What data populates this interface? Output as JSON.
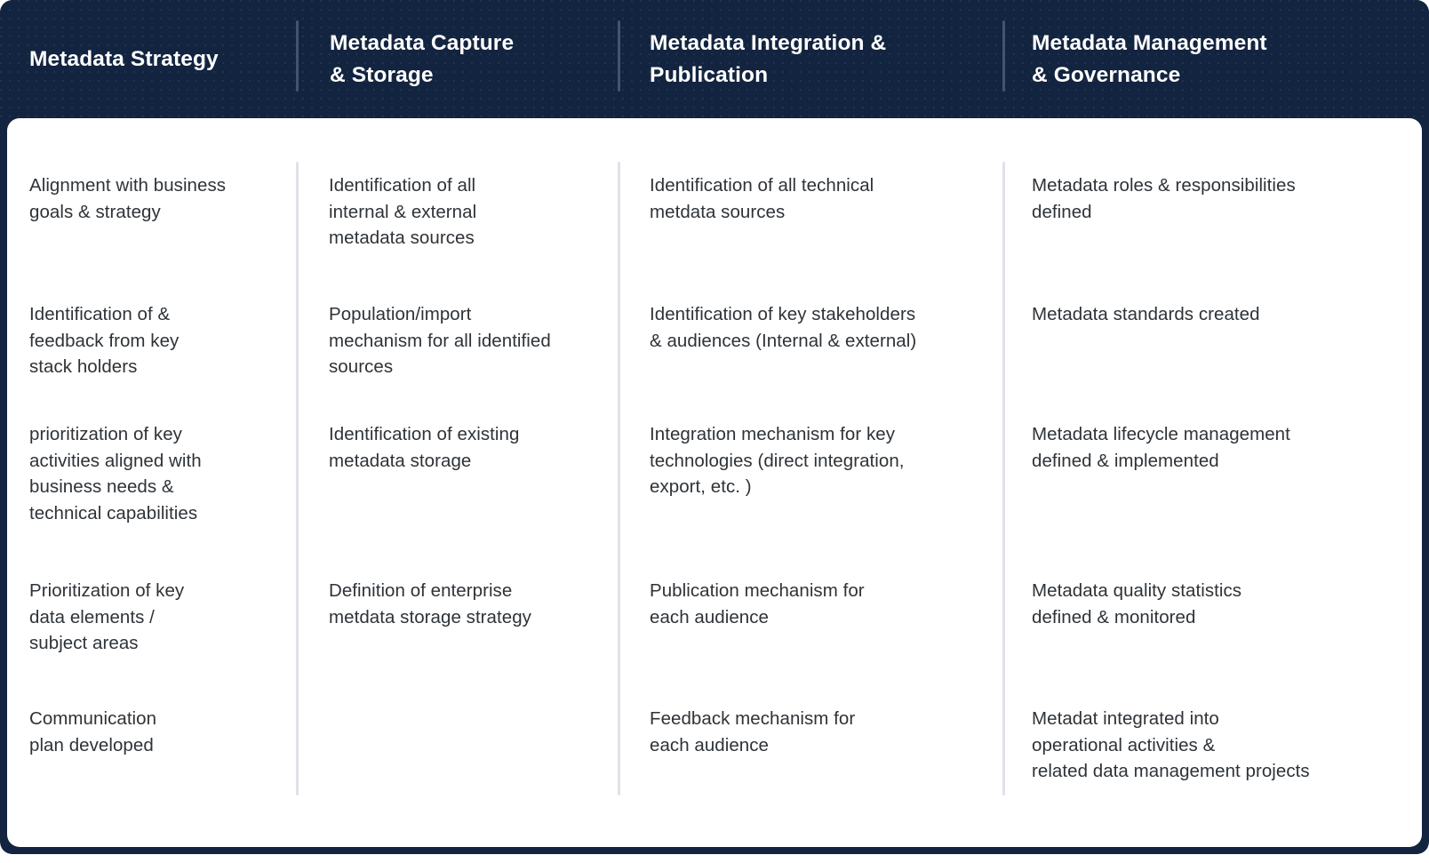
{
  "colors": {
    "header_background": "#12243f",
    "header_text": "#ffffff",
    "header_divider": "#41556f",
    "panel_background": "#ffffff",
    "body_text": "#2e3338",
    "body_divider": "#dfe2e8",
    "page_background": "#ffffff"
  },
  "columns": [
    {
      "title": "Metadata Strategy",
      "items": [
        "Alignment with business\ngoals & strategy",
        "Identification of &\nfeedback from key\nstack holders",
        "prioritization of key\nactivities aligned with\nbusiness needs &\ntechnical capabilities",
        "Prioritization of key\ndata elements /\nsubject areas",
        "Communication\nplan developed"
      ]
    },
    {
      "title": "Metadata Capture\n& Storage",
      "items": [
        "Identification of all\ninternal & external\nmetadata sources",
        "Population/import\nmechanism for all identified\nsources",
        "Identification of existing\nmetadata storage",
        "Definition of enterprise\nmetdata storage strategy",
        ""
      ]
    },
    {
      "title": "Metadata Integration &\nPublication",
      "items": [
        "Identification of all technical\nmetdata sources",
        "Identification of key stakeholders\n& audiences (Internal & external)",
        "Integration mechanism for key\ntechnologies (direct integration,\nexport, etc. )",
        "Publication mechanism for\neach audience",
        "Feedback mechanism for\neach audience"
      ]
    },
    {
      "title": "Metadata Management\n& Governance",
      "items": [
        "Metadata roles & responsibilities\ndefined",
        "Metadata standards created",
        "Metadata lifecycle management\ndefined & implemented",
        "Metadata quality statistics\ndefined & monitored",
        "Metadat integrated into\noperational activities &\nrelated data management projects"
      ]
    }
  ]
}
